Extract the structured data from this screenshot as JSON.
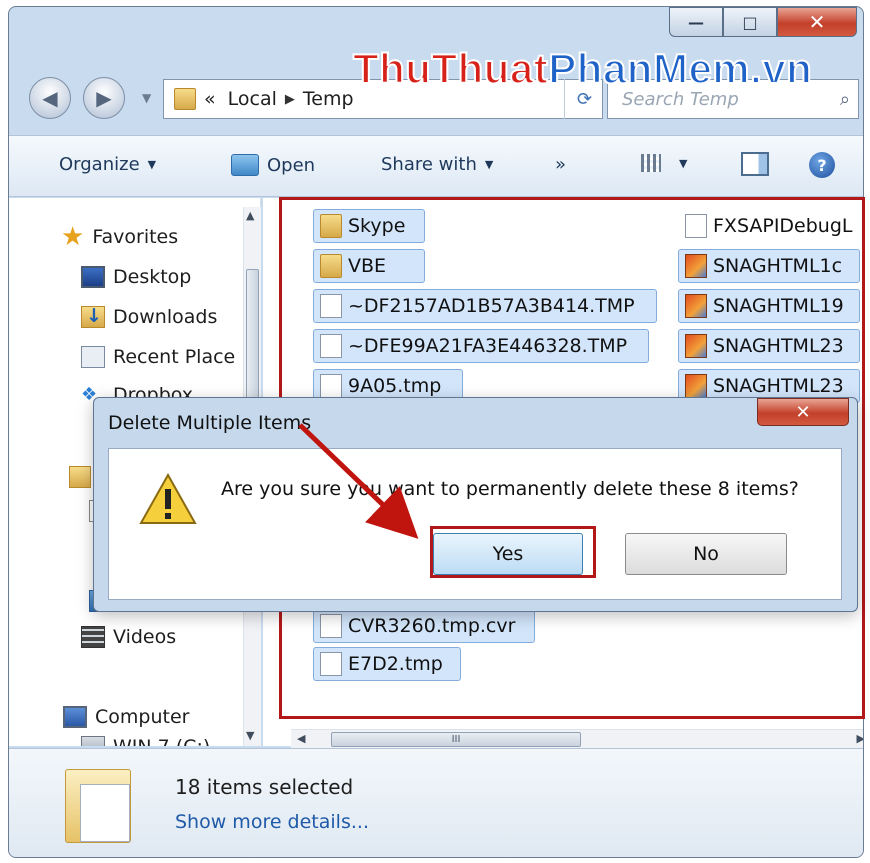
{
  "window": {
    "controls": {
      "minimize": "—",
      "maximize": "□",
      "close": "✕"
    }
  },
  "address": {
    "back_glyph": "◀",
    "forward_glyph": "▶",
    "overflow": "«",
    "segments": [
      "Local",
      "Temp"
    ],
    "refresh_glyph": "⟳",
    "search_placeholder": "Search Temp",
    "search_glyph": "⌕"
  },
  "watermark": {
    "part1": "ThuThuat",
    "part2": "PhanMem.vn"
  },
  "toolbar": {
    "organize": "Organize",
    "open": "Open",
    "share_with": "Share with",
    "more": "»",
    "help": "?"
  },
  "nav": {
    "favorites": "Favorites",
    "desktop": "Desktop",
    "downloads": "Downloads",
    "recent_places": "Recent Place",
    "dropbox": "Dropbox",
    "videos": "Videos",
    "computer": "Computer",
    "drive": "WIN 7 (C:)"
  },
  "files": {
    "left": [
      {
        "name": "Skype",
        "icon": "folder-icon"
      },
      {
        "name": "VBE",
        "icon": "folder-icon"
      },
      {
        "name": "~DF2157AD1B57A3B414.TMP",
        "icon": "document-icon"
      },
      {
        "name": "~DFE99A21FA3E446328.TMP",
        "icon": "document-icon"
      },
      {
        "name": "9A05.tmp",
        "icon": "document-icon"
      },
      {
        "name": "CVR3260.tmp.cvr",
        "icon": "document-icon"
      },
      {
        "name": "E7D2.tmp",
        "icon": "document-icon"
      }
    ],
    "right": [
      {
        "name": "FXSAPIDebugL",
        "icon": "document-icon"
      },
      {
        "name": "SNAGHTML1c",
        "icon": "image-icon"
      },
      {
        "name": "SNAGHTML19",
        "icon": "image-icon"
      },
      {
        "name": "SNAGHTML23",
        "icon": "image-icon"
      },
      {
        "name": "SNAGHTML23",
        "icon": "image-icon"
      }
    ]
  },
  "hscroll": {
    "thumb_grip": "III"
  },
  "details": {
    "selection": "18 items selected",
    "more_link": "Show more details..."
  },
  "dialog": {
    "title": "Delete Multiple Items",
    "close": "✕",
    "message": "Are you sure you want to permanently delete these 8 items?",
    "yes": "Yes",
    "no": "No"
  },
  "colors": {
    "highlight_red": "#b31818",
    "watermark_red": "#d7221a",
    "watermark_blue": "#1f63c8",
    "selection_blue": "#d2e5fb"
  }
}
